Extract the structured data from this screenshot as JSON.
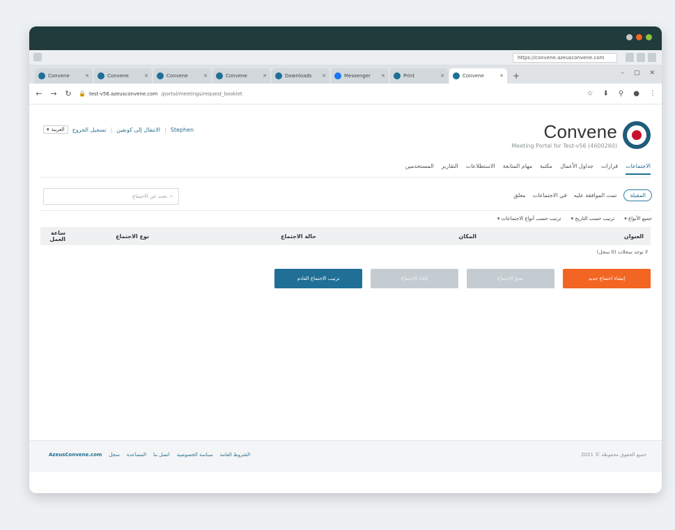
{
  "window": {
    "controls_colors": [
      "#c8c8c8",
      "#f26522",
      "#8fbf3f"
    ]
  },
  "os_bar": {
    "url": "https://convene.azeusconvene.com"
  },
  "tabs": [
    {
      "title": "Convene",
      "color": "#1f6f96"
    },
    {
      "title": "Convene",
      "color": "#1f6f96"
    },
    {
      "title": "Convene",
      "color": "#1f6f96"
    },
    {
      "title": "Convene",
      "color": "#1f6f96"
    },
    {
      "title": "Downloads",
      "color": "#1f6f96"
    },
    {
      "title": "Messenger",
      "color": "#1877f2"
    },
    {
      "title": "Print",
      "color": "#1f6f96"
    },
    {
      "title": "Convene",
      "color": "#1f6f96",
      "active": true
    }
  ],
  "address_bar": {
    "host": "test-v56.azeusconvene.com",
    "path": "/portal/meetings/request_booklet"
  },
  "header": {
    "brand_name": "Convene",
    "brand_subtitle": "Meeting Portal for Test-v56 (4600260)",
    "links": [
      "Stephen",
      "الانتقال إلى كونفين",
      "تسجيل الخروج"
    ],
    "language": "العربية"
  },
  "main_nav": {
    "items": [
      "الاجتماعات",
      "قرارات",
      "جداول الأعمال",
      "مكتبة",
      "مهام المتابعة",
      "الاستطلاعات",
      "التقارير",
      "المستخدمين"
    ],
    "active_index": 0
  },
  "sub_tabs": {
    "items": [
      "المقبلة",
      "تمت الموافقة عليه",
      "في الاجتماعات",
      "مغلق"
    ],
    "active_index": 0
  },
  "search": {
    "placeholder": "بحث عن الاجتماع"
  },
  "filters": [
    "جميع الأنواع",
    "ترتيب حسب التاريخ",
    "ترتيب حسب أنواع الاجتماعات"
  ],
  "table": {
    "headers": [
      "العنوان",
      "المكان",
      "حالة الاجتماع",
      "نوع الاجتماع",
      "ساعة العمل"
    ],
    "count_text": "لا توجد سجلات (0 سجل)"
  },
  "buttons": {
    "create": "إنشاء اجتماع جديد",
    "b2": "نسخ الاجتماع",
    "b3": "إلغاء الاجتماع",
    "b4": "ترتيب الاجتماع القادم"
  },
  "footer": {
    "copyright": "جميع الحقوق محفوظة © 2021",
    "links": [
      "الشروط العامة",
      "سياسة الخصوصية",
      "اتصل بنا",
      "المساعدة",
      "سجل"
    ],
    "brand_link": "AzeusConvene.com"
  },
  "colors": {
    "orange": "#f26522",
    "blue": "#1f6f96",
    "grey_btn": "#c5ccd1",
    "titlebar": "#1f3b3c"
  }
}
